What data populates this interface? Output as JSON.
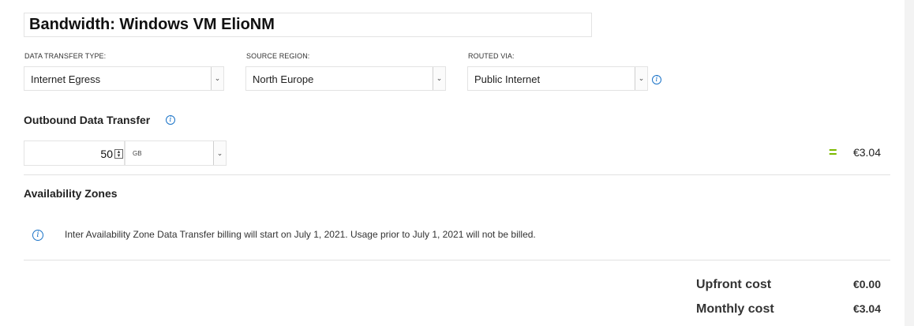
{
  "estimate": {
    "title": "Bandwidth: Windows VM ElioNM"
  },
  "fields": {
    "data_transfer_type": {
      "label": "DATA TRANSFER TYPE:",
      "value": "Internet Egress"
    },
    "source_region": {
      "label": "SOURCE REGION:",
      "value": "North Europe"
    },
    "routed_via": {
      "label": "ROUTED VIA:",
      "value": "Public Internet"
    }
  },
  "outbound": {
    "title": "Outbound Data Transfer",
    "quantity": "50",
    "unit": "GB",
    "equals": "=",
    "price": "€3.04"
  },
  "availability_zones": {
    "title": "Availability Zones",
    "notice": "Inter Availability Zone Data Transfer billing will start on July 1, 2021. Usage prior to July 1, 2021 will not be billed."
  },
  "summary": {
    "upfront_label": "Upfront cost",
    "upfront_value": "€0.00",
    "monthly_label": "Monthly cost",
    "monthly_value": "€3.04"
  },
  "icons": {
    "info": "info-icon",
    "dropdown": "chevron-down-icon",
    "spinner": "spinner-icon"
  },
  "colors": {
    "accent_blue": "#1a73c8",
    "equals_green": "#7cb900"
  }
}
